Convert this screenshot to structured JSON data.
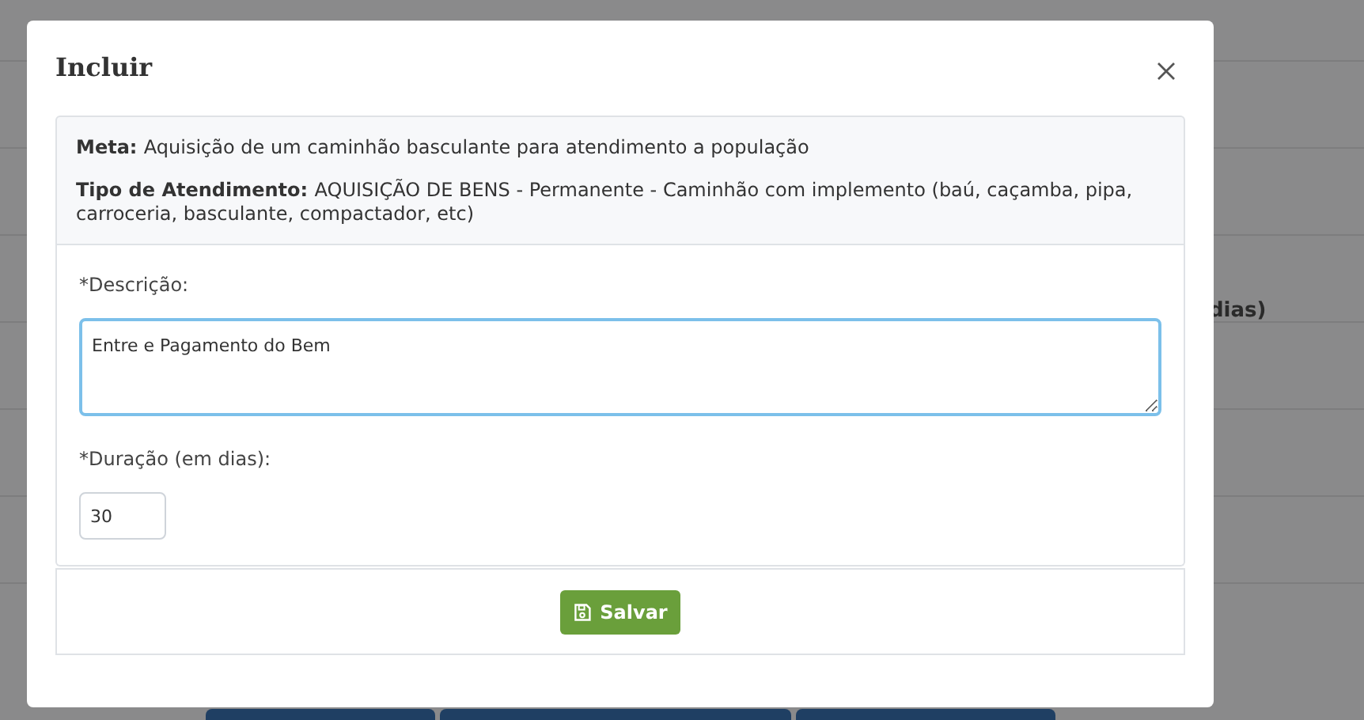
{
  "background": {
    "column_header_fragment": "dias)"
  },
  "dialog": {
    "title": "Incluir",
    "info": {
      "meta_label": "Meta:",
      "meta": "Aquisição de um caminhão basculante para atendimento a população",
      "tipo_label": "Tipo de Atendimento:",
      "tipo": "AQUISIÇÃO DE BENS - Permanente - Caminhão com implemento (baú, caçamba, pipa, carroceria, basculante, compactador, etc)"
    },
    "fields": [
      {
        "kind": "textarea",
        "label": "*Descrição:",
        "value": "Entre e Pagamento do Bem",
        "focused": true
      },
      {
        "kind": "input",
        "label": "*Duração (em dias):",
        "value": "30",
        "focused": false
      }
    ],
    "save_button": "Salvar"
  }
}
